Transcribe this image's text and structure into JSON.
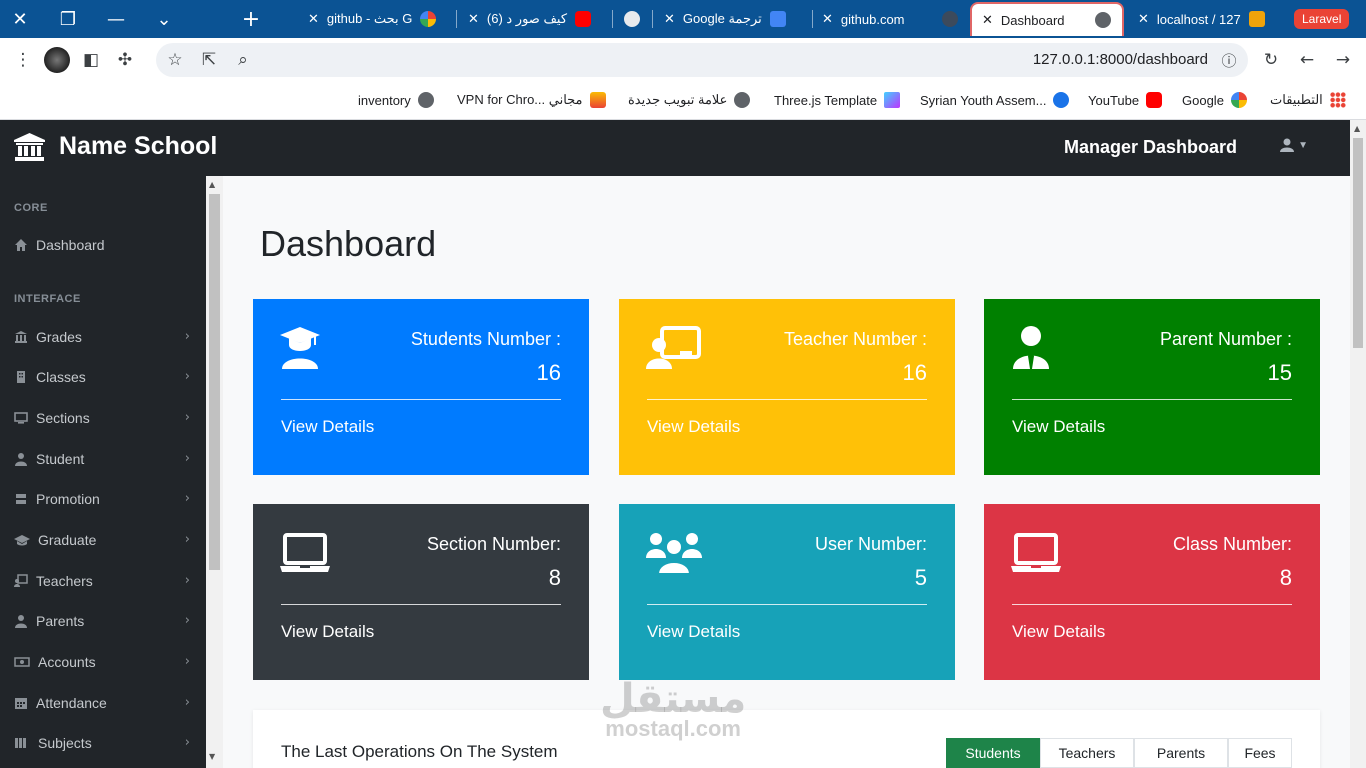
{
  "browser": {
    "tabs": [
      {
        "title": "github - بحث G",
        "active": false
      },
      {
        "title": "(6) كيف صور د",
        "active": false
      },
      {
        "title": "",
        "active": false
      },
      {
        "title": "Google ترجمة",
        "active": false
      },
      {
        "title": "github.com",
        "active": false
      },
      {
        "title": "Dashboard",
        "active": true
      },
      {
        "title": "localhost / 127",
        "active": false
      },
      {
        "title": "Laravel",
        "active": false
      }
    ],
    "url": "127.0.0.1:8000/dashboard",
    "bookmarks": [
      {
        "label": "inventory"
      },
      {
        "label": "VPN for Chro... مجاني"
      },
      {
        "label": "علامة تبويب جديدة"
      },
      {
        "label": "Three.js Template"
      },
      {
        "label": "Syrian Youth Assem..."
      },
      {
        "label": "YouTube"
      },
      {
        "label": "Google"
      },
      {
        "label": "التطبيقات"
      }
    ]
  },
  "navbar": {
    "brand": "Name School",
    "title": "Manager Dashboard"
  },
  "sidebar": {
    "sections": [
      "CORE",
      "INTERFACE"
    ],
    "items": [
      {
        "label": "Dashboard",
        "icon": "home-icon"
      },
      {
        "label": "Grades",
        "icon": "institution-icon"
      },
      {
        "label": "Classes",
        "icon": "building-icon"
      },
      {
        "label": "Sections",
        "icon": "desktop-icon"
      },
      {
        "label": "Student",
        "icon": "user-icon"
      },
      {
        "label": "Promotion",
        "icon": "promotion-icon"
      },
      {
        "label": "Graduate",
        "icon": "graduation-cap-icon"
      },
      {
        "label": "Teachers",
        "icon": "chalkboard-icon"
      },
      {
        "label": "Parents",
        "icon": "user-tie-icon"
      },
      {
        "label": "Accounts",
        "icon": "money-icon"
      },
      {
        "label": "Attendance",
        "icon": "calendar-icon"
      },
      {
        "label": "Subjects",
        "icon": "book-icon"
      }
    ]
  },
  "main": {
    "title": "Dashboard",
    "cards": [
      {
        "label": "Students Number :",
        "value": "16",
        "link": "View Details",
        "color": "#007bff",
        "icon": "graduate-icon"
      },
      {
        "label": "Teacher Number :",
        "value": "16",
        "link": "View Details",
        "color": "#ffc107",
        "icon": "teacher-icon"
      },
      {
        "label": "Parent Number :",
        "value": "15",
        "link": "View Details",
        "color": "#008000",
        "icon": "parent-icon"
      },
      {
        "label": "Section Number:",
        "value": "8",
        "link": "View Details",
        "color": "#343a40",
        "icon": "laptop-icon"
      },
      {
        "label": "User Number:",
        "value": "5",
        "link": "View Details",
        "color": "#17a2b8",
        "icon": "users-icon"
      },
      {
        "label": "Class Number:",
        "value": "8",
        "link": "View Details",
        "color": "#dc3545",
        "icon": "laptop-icon"
      }
    ],
    "operations": {
      "title": "The Last Operations On The System",
      "tabs": [
        "Students",
        "Teachers",
        "Parents",
        "Fees"
      ]
    }
  },
  "watermark": {
    "arabic": "مستقل",
    "latin": "mostaql.com"
  }
}
